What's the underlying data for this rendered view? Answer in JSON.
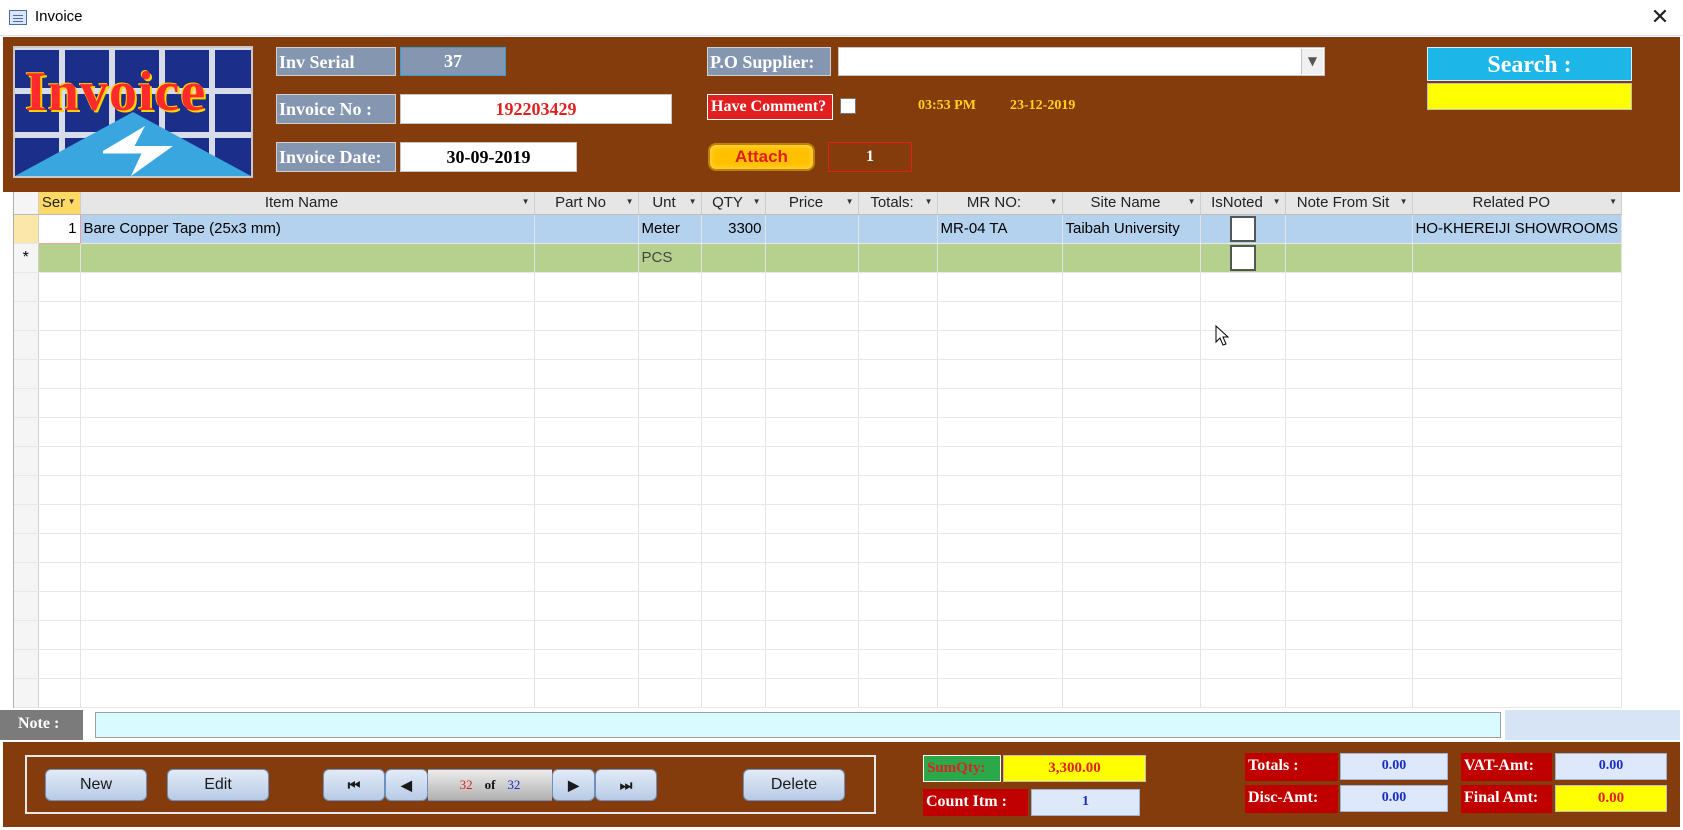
{
  "window": {
    "title": "Invoice",
    "close_glyph": "✕",
    "icon": "form-window-icon"
  },
  "logo": {
    "text": "Invoice"
  },
  "header": {
    "inv_serial_label": "Inv Serial",
    "inv_serial_value": "37",
    "invoice_no_label": "Invoice No :",
    "invoice_no_value": "192203429",
    "invoice_date_label": "Invoice Date:",
    "invoice_date_value": "30-09-2019",
    "po_supplier_label": "P.O Supplier:",
    "po_supplier_value": "",
    "have_comment_label": "Have Comment?",
    "have_comment_checked": false,
    "time": "03:53 PM",
    "date": "23-12-2019",
    "attach_label": "Attach",
    "attach_count": "1",
    "search_label": "Search :",
    "search_value": ""
  },
  "grid": {
    "columns": [
      "Ser",
      "Item Name",
      "Part No",
      "Unt",
      "QTY",
      "Price",
      "Totals:",
      "MR NO:",
      "Site Name",
      "IsNoted",
      "Note From Sit",
      "Related PO"
    ],
    "rows": [
      {
        "ser": "1",
        "item_name": "Bare Copper Tape (25x3 mm)",
        "part_no": "",
        "unt": "Meter",
        "qty": "3300",
        "price": "",
        "totals": "",
        "mr_no": "MR-04 TA",
        "site_name": "Taibah University",
        "is_noted": false,
        "note_from_site": "",
        "related_po": "HO-KHEREIJI SHOWROOMS"
      }
    ],
    "new_row": {
      "marker": "*",
      "unt": "PCS"
    }
  },
  "note": {
    "label": "Note :",
    "value": ""
  },
  "footer": {
    "new_label": "New",
    "edit_label": "Edit",
    "first_glyph": "⏮",
    "prev_glyph": "◀",
    "record_current": "32",
    "record_of": "of",
    "record_total": "32",
    "next_glyph": "▶",
    "last_glyph": "⏭",
    "delete_label": "Delete",
    "sumqty_label": "SumQty:",
    "sumqty_value": "3,300.00",
    "countitm_label": "Count Itm :",
    "countitm_value": "1",
    "totals_label": "Totals :",
    "totals_value": "0.00",
    "disc_label": "Disc-Amt:",
    "disc_value": "0.00",
    "vat_label": "VAT-Amt:",
    "vat_value": "0.00",
    "final_label": "Final Amt:",
    "final_value": "0.00"
  },
  "colors": {
    "header_bg": "#843c0c",
    "label_blue": "#8496b0",
    "accent_red": "#e02020",
    "search_blue": "#1cb6e8",
    "yellow": "#ffff00",
    "row_selected": "#b4d2ee",
    "row_new": "#b6d18d"
  }
}
